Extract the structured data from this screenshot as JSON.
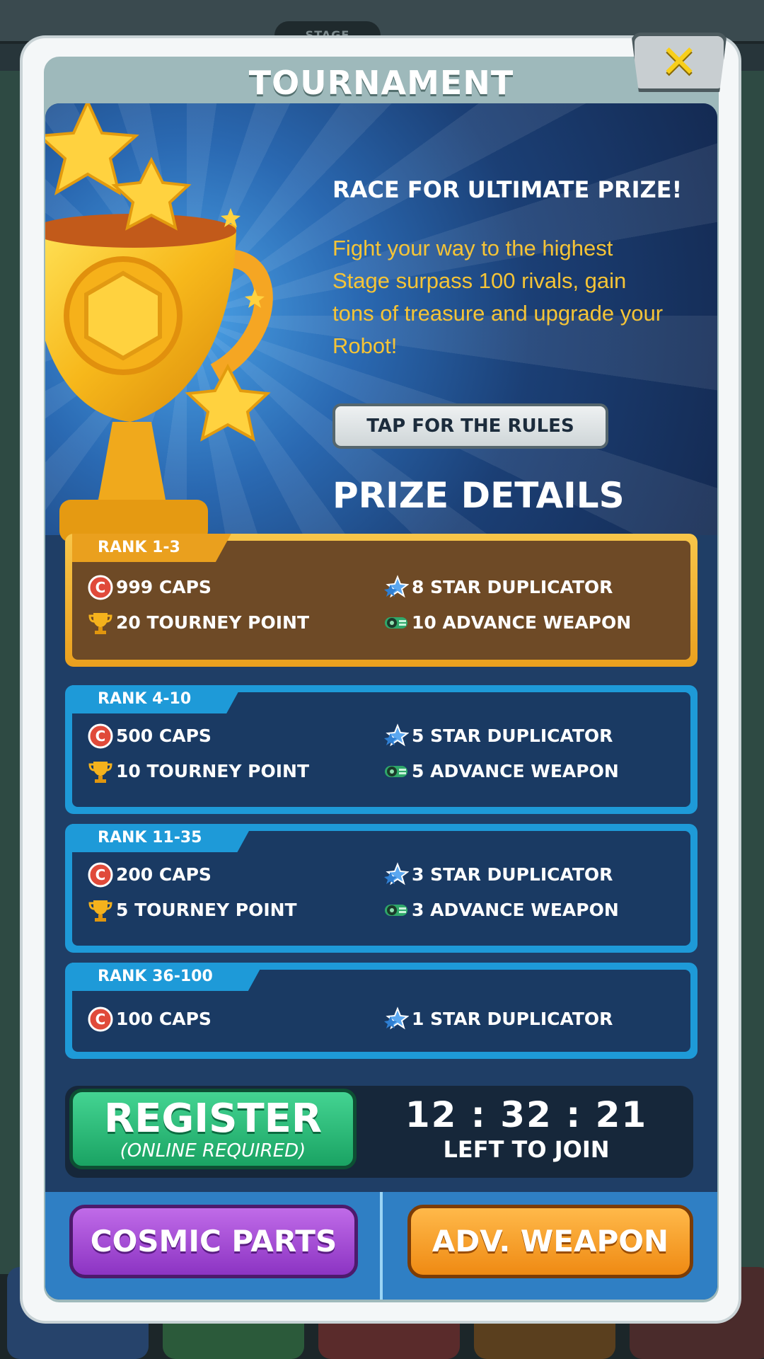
{
  "background": {
    "stage_label": "STAGE"
  },
  "dialog": {
    "title": "TOURNAMENT",
    "close_icon": "close-x-icon"
  },
  "hero": {
    "heading": "RACE FOR ULTIMATE PRIZE!",
    "description": "Fight your way to the highest Stage surpass 100 rivals, gain tons of treasure and upgrade your Robot!",
    "rules_button": "TAP FOR THE RULES",
    "prize_heading": "PRIZE DETAILS"
  },
  "ranks": [
    {
      "label": "RANK 1-3",
      "caps": "999 CAPS",
      "tourney": "20 TOURNEY POINT",
      "star": "8 STAR DUPLICATOR",
      "weapon": "10 ADVANCE WEAPON"
    },
    {
      "label": "RANK 4-10",
      "caps": "500 CAPS",
      "tourney": "10 TOURNEY POINT",
      "star": "5 STAR DUPLICATOR",
      "weapon": "5 ADVANCE WEAPON"
    },
    {
      "label": "RANK 11-35",
      "caps": "200 CAPS",
      "tourney": "5 TOURNEY POINT",
      "star": "3 STAR DUPLICATOR",
      "weapon": "3 ADVANCE WEAPON"
    },
    {
      "label": "RANK 36-100",
      "caps": "100 CAPS",
      "star": "1 STAR DUPLICATOR"
    }
  ],
  "register": {
    "label": "REGISTER",
    "sublabel": "(ONLINE REQUIRED)",
    "timer": "12 : 32 : 21",
    "timer_label": "LEFT TO JOIN"
  },
  "bottom_buttons": {
    "cosmic": "COSMIC PARTS",
    "adv_weapon": "ADV. WEAPON"
  },
  "colors": {
    "gold_card": "#eaa01e",
    "blue_card": "#1e9ad8",
    "register_green": "#1aa363",
    "cosmic_purple": "#8c34c3",
    "adv_orange": "#ef8a13"
  }
}
